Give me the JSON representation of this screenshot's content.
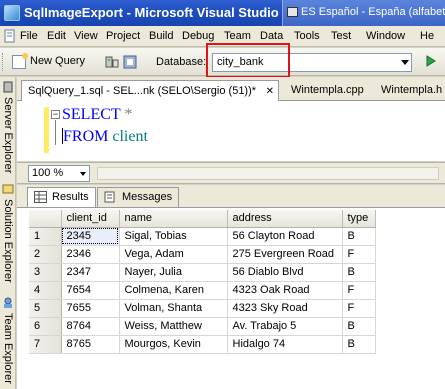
{
  "window": {
    "title": "SqlImageExport - Microsoft Visual Studio",
    "language_indicator": "ES Español - España (alfabet"
  },
  "menu": [
    "File",
    "Edit",
    "View",
    "Project",
    "Build",
    "Debug",
    "Team",
    "Data",
    "Tools",
    "Test",
    "Window",
    "He"
  ],
  "toolbar": {
    "new_query": "New Query",
    "database_label": "Database:",
    "database_value": "city_bank"
  },
  "side_tabs": [
    "Server Explorer",
    "Solution Explorer",
    "Team Explorer"
  ],
  "doc_tabs": [
    {
      "label": "SqlQuery_1.sql - SEL...nk (SELO\\Sergio (51))*",
      "close": "✕"
    },
    {
      "label": "Wintempla.cpp"
    },
    {
      "label": "Wintempla.h"
    }
  ],
  "editor": {
    "line1_keyword": "SELECT",
    "line1_rest": " *",
    "line2_keyword": "FROM",
    "line2_table": " client",
    "collapse_symbol": "−"
  },
  "zoom": "100 %",
  "results_tabs": [
    "Results",
    "Messages"
  ],
  "grid": {
    "columns": [
      "client_id",
      "name",
      "address",
      "type"
    ],
    "rows": [
      {
        "n": "1",
        "client_id": "2345",
        "name": "Sigal, Tobias",
        "address": "56 Clayton Road",
        "type": "B"
      },
      {
        "n": "2",
        "client_id": "2346",
        "name": "Vega, Adam",
        "address": "275 Evergreen Road",
        "type": "F"
      },
      {
        "n": "3",
        "client_id": "2347",
        "name": "Nayer, Julia",
        "address": "56 Diablo Blvd",
        "type": "B"
      },
      {
        "n": "4",
        "client_id": "7654",
        "name": "Colmena, Karen",
        "address": "4323 Oak Road",
        "type": "F"
      },
      {
        "n": "5",
        "client_id": "7655",
        "name": "Volman, Shanta",
        "address": "4323 Sky Road",
        "type": "F"
      },
      {
        "n": "6",
        "client_id": "8764",
        "name": "Weiss, Matthew",
        "address": "Av. Trabajo 5",
        "type": "B"
      },
      {
        "n": "7",
        "client_id": "8765",
        "name": "Mourgos, Kevin",
        "address": "Hidalgo 74",
        "type": "B"
      }
    ]
  },
  "colors": {
    "title_bar": "#1f4fbf",
    "highlight_box": "#e0121a",
    "sql_keyword": "#0000ff",
    "sql_table": "#008080"
  }
}
